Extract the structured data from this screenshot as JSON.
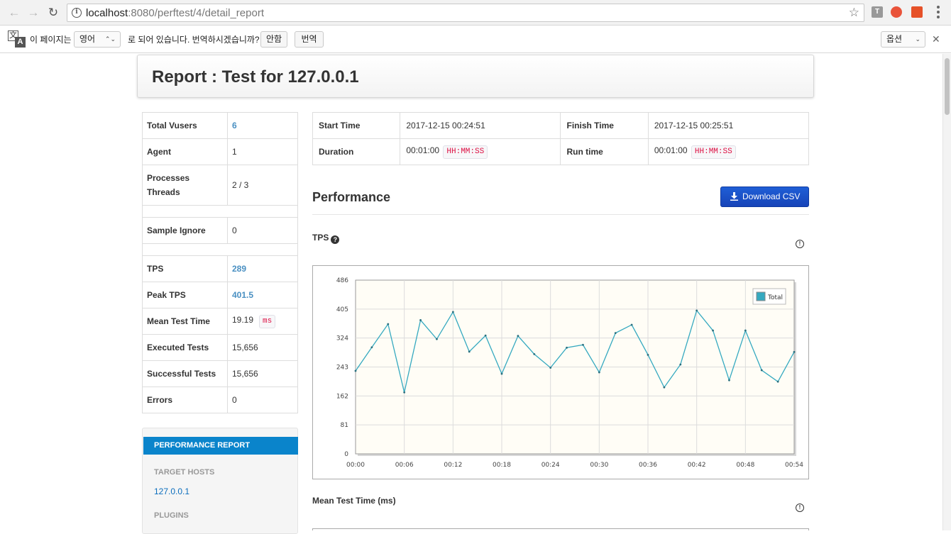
{
  "browser": {
    "url_host": "localhost",
    "url_path": ":8080/perftest/4/detail_report",
    "ext_t_label": "T"
  },
  "translate_bar": {
    "prefix": "이 페이지는",
    "language": "영어",
    "suffix": "로 되어 있습니다. 번역하시겠습니까?",
    "no_button": "안함",
    "translate_button": "번역",
    "options": "옵션"
  },
  "header": {
    "title": "Report : Test for 127.0.0.1"
  },
  "summary": [
    {
      "label": "Total Vusers",
      "value": "6",
      "link": true
    },
    {
      "label": "Agent",
      "value": "1"
    },
    {
      "label": "Processes\nThreads",
      "value": "2 / 3",
      "tall": true
    },
    {
      "spacer": true
    },
    {
      "label": "Sample Ignore",
      "value": "0"
    },
    {
      "spacer": true
    },
    {
      "label": "TPS",
      "value": "289",
      "link": true
    },
    {
      "label": "Peak TPS",
      "value": "401.5",
      "link": true
    },
    {
      "label": "Mean Test Time",
      "value": "19.19",
      "badge": "ms"
    },
    {
      "label": "Executed Tests",
      "value": "15,656"
    },
    {
      "label": "Successful Tests",
      "value": "15,656"
    },
    {
      "label": "Errors",
      "value": "0"
    }
  ],
  "sidebar": {
    "active_item": "PERFORMANCE REPORT",
    "target_hosts_header": "TARGET HOSTS",
    "target_host": "127.0.0.1",
    "plugins_header": "PLUGINS"
  },
  "times": {
    "start_label": "Start Time",
    "start_value": "2017-12-15 00:24:51",
    "finish_label": "Finish Time",
    "finish_value": "2017-12-15 00:25:51",
    "duration_label": "Duration",
    "duration_value": "00:01:00",
    "runtime_label": "Run time",
    "runtime_value": "00:01:00",
    "format_badge": "HH:MM:SS"
  },
  "performance": {
    "title": "Performance",
    "download_label": "Download CSV",
    "tps_label": "TPS",
    "mean_test_time_label": "Mean Test Time (ms)"
  },
  "chart_data": {
    "type": "line",
    "title": "",
    "xlabel": "",
    "ylabel": "",
    "ylim": [
      0,
      486
    ],
    "xlim": [
      0,
      54
    ],
    "y_ticks": [
      "0",
      "81",
      "162",
      "243",
      "324",
      "405",
      "486"
    ],
    "x_ticks": [
      "00:00",
      "00:06",
      "00:12",
      "00:18",
      "00:24",
      "00:30",
      "00:36",
      "00:42",
      "00:48",
      "00:54"
    ],
    "grid": true,
    "legend_position": "top-right",
    "series": [
      {
        "name": "Total",
        "color": "#35a9c0",
        "x": [
          0,
          2,
          4,
          6,
          8,
          10,
          12,
          14,
          16,
          18,
          20,
          22,
          24,
          26,
          28,
          30,
          32,
          34,
          36,
          38,
          40,
          42,
          44,
          46,
          48,
          50,
          52,
          54
        ],
        "y": [
          232,
          298,
          363,
          172,
          374,
          321,
          397,
          286,
          331,
          224,
          330,
          279,
          241,
          297,
          305,
          228,
          338,
          361,
          277,
          186,
          250,
          401,
          345,
          206,
          345,
          234,
          202,
          285
        ]
      }
    ]
  }
}
